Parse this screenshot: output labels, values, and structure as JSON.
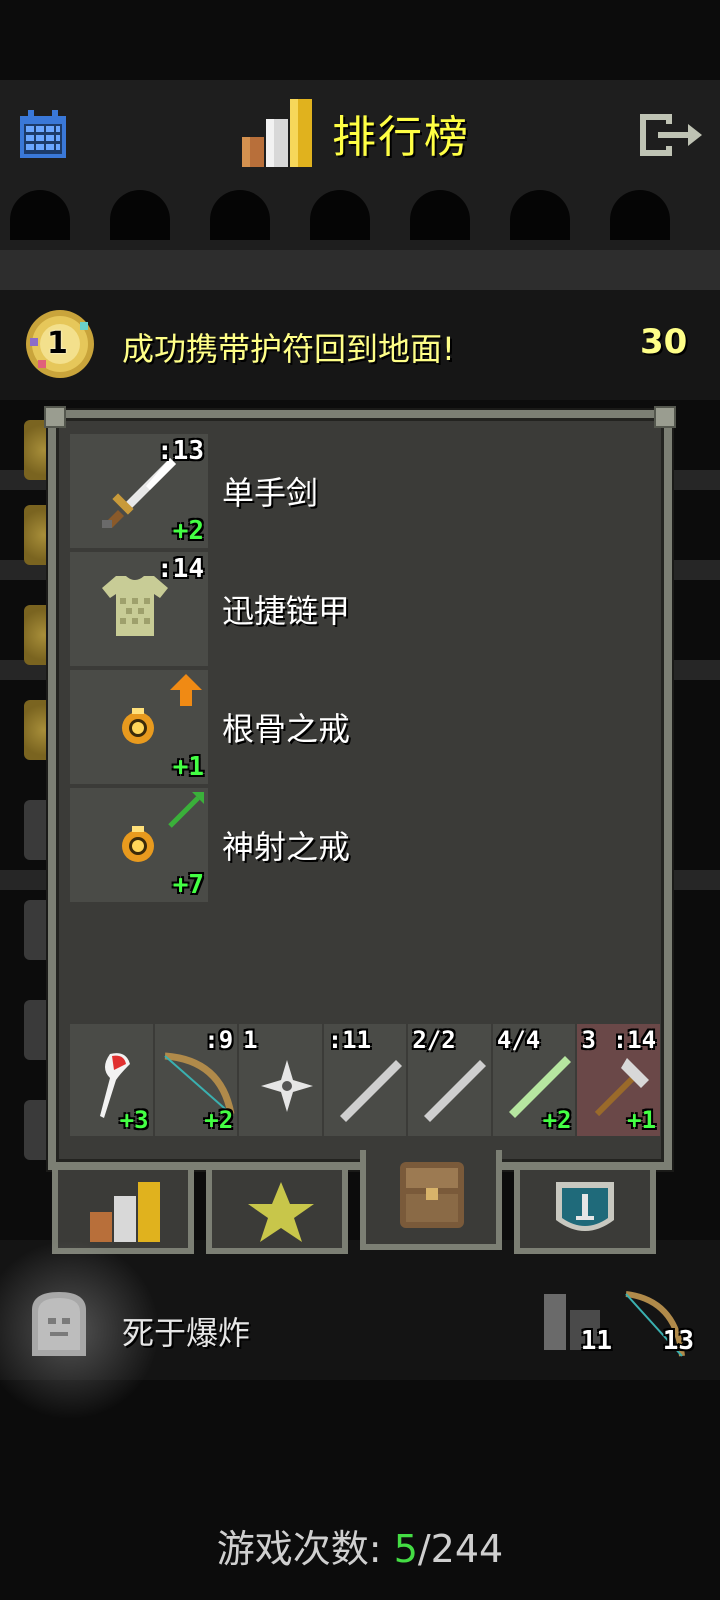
{
  "header": {
    "title": "排行榜"
  },
  "rank": {
    "place": "1",
    "text": "成功携带护符回到地面!",
    "score": "30"
  },
  "equipment": [
    {
      "name": "单手剑",
      "icon": "sword-icon",
      "top": ":13",
      "bottom": "+2"
    },
    {
      "name": "迅捷链甲",
      "icon": "chainmail-icon",
      "top": ":14",
      "bottom": ""
    },
    {
      "name": "根骨之戒",
      "icon": "ring-icon",
      "top": "",
      "bottom": "+1",
      "marker": "up-arrow-icon"
    },
    {
      "name": "神射之戒",
      "icon": "ring-icon",
      "top": "",
      "bottom": "+7",
      "marker": "arrow-icon"
    }
  ],
  "quickslots": [
    {
      "icon": "feather-dart-icon",
      "top_left": "",
      "top": "",
      "bottom": "+3"
    },
    {
      "icon": "bow-icon",
      "top_left": "",
      "top": ":9",
      "bottom": "+2"
    },
    {
      "icon": "shuriken-icon",
      "top_left": "1",
      "top": "",
      "bottom": ""
    },
    {
      "icon": "wand-icon",
      "top_left": ":11",
      "top": "",
      "bottom": ""
    },
    {
      "icon": "wand-icon",
      "top_left": "2/2",
      "top": "",
      "bottom": ""
    },
    {
      "icon": "wand-green-icon",
      "top_left": "4/4",
      "top": "",
      "bottom": "+2"
    },
    {
      "icon": "axe-icon",
      "top_left": "3",
      "top": ":14",
      "bottom": "+1",
      "cursed": true
    }
  ],
  "tabs": [
    {
      "name": "rankings-tab",
      "icon": "bars-icon"
    },
    {
      "name": "badges-tab",
      "icon": "star-icon"
    },
    {
      "name": "items-tab",
      "icon": "backpack-icon",
      "active": true
    },
    {
      "name": "stats-tab",
      "icon": "sword-shield-icon"
    }
  ],
  "death": {
    "text": "死于爆炸",
    "items": [
      {
        "count": "11"
      },
      {
        "count": "13"
      }
    ]
  },
  "footer": {
    "label": "游戏次数:",
    "current": "5",
    "total": "/244"
  },
  "colors": {
    "title": "#ffff44",
    "highlight": "#44ff44",
    "rank_text": "#ffff88"
  }
}
